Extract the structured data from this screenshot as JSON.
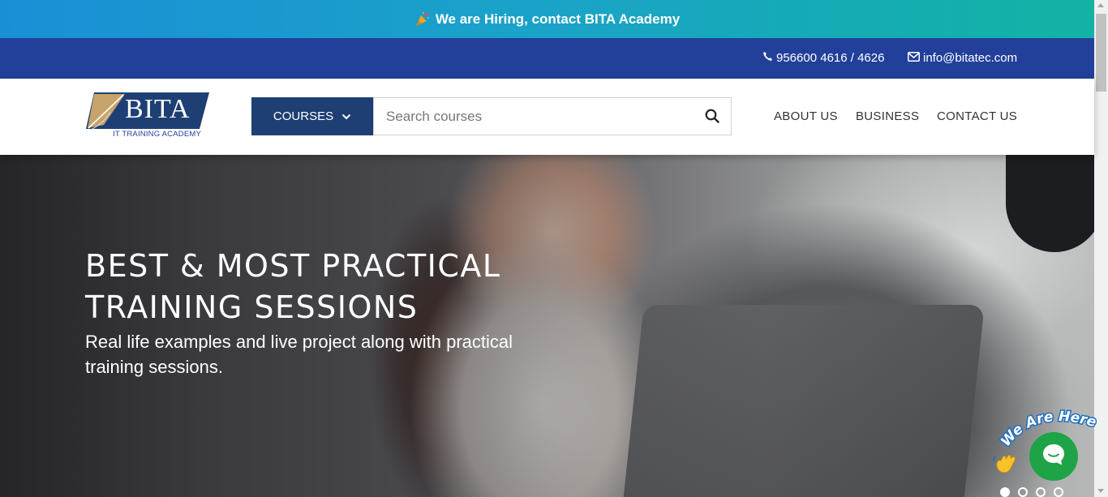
{
  "announcement": {
    "icon": "party-popper-icon",
    "text": "We are Hiring, contact BITA Academy"
  },
  "contact": {
    "phone_icon": "phone-icon",
    "phone": "956600 4616 / 4626",
    "email_icon": "envelope-icon",
    "email": "info@bitatec.com"
  },
  "logo": {
    "name": "BITA",
    "tagline": "IT TRAINING ACADEMY"
  },
  "header": {
    "courses_label": "COURSES",
    "search_placeholder": "Search courses",
    "search_value": "",
    "nav": [
      "ABOUT US",
      "BUSINESS",
      "CONTACT US"
    ]
  },
  "hero": {
    "title": "BEST & MOST PRACTICAL TRAINING SESSIONS",
    "subtitle": "Real life examples and live project along with practical training sessions.",
    "slides_total": 4,
    "slide_active": 1
  },
  "chat": {
    "badge_text": "We Are Here!",
    "icon": "chat-bubble-icon"
  },
  "colors": {
    "banner_start": "#1a8fd6",
    "banner_end": "#12b3a4",
    "contact_bar": "#22409a",
    "courses_button": "#1e3f73",
    "chat": "#1ea446"
  }
}
